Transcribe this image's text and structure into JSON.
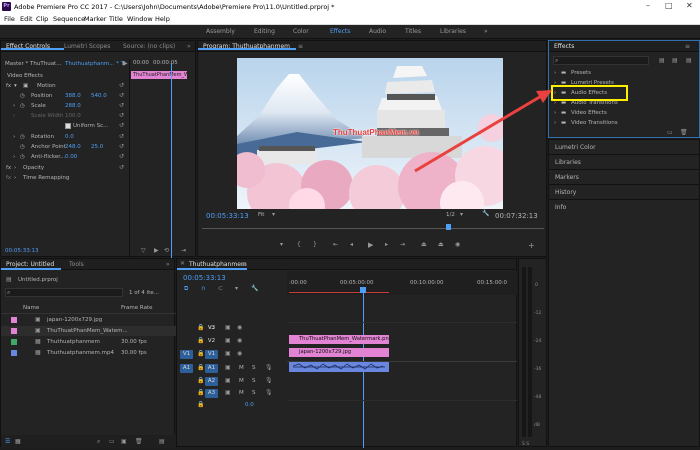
{
  "window": {
    "title": "Adobe Premiere Pro CC 2017 - C:\\Users\\John\\Documents\\Adobe\\Premiere Pro\\11.0\\Untitled.prproj *",
    "app_icon": "Pr"
  },
  "menu": [
    "File",
    "Edit",
    "Clip",
    "Sequence",
    "Marker",
    "Title",
    "Window",
    "Help"
  ],
  "workspaces": [
    "Assembly",
    "Editing",
    "Color",
    "Effects",
    "Audio",
    "Titles",
    "Libraries"
  ],
  "workspace_more": "»",
  "effect_controls": {
    "tabs": [
      "Effect Controls",
      "Lumetri Scopes",
      "Source: (no clips)"
    ],
    "tab_more": "»",
    "master": "Master * ThuThuat...",
    "clip": "Thuthuatphanm... * ThuThuat...",
    "ruler": [
      "00:00",
      "00:00:05"
    ],
    "clip_bar": "ThuThuatPhanMem_W",
    "section": "Video Effects",
    "motion": "Motion",
    "position_label": "Position",
    "position_x": "388.0",
    "position_y": "540.0",
    "scale_label": "Scale",
    "scale_val": "288.0",
    "scale_width_label": "Scale Width",
    "scale_width_val": "100.0",
    "uniform_scale": "Uniform Sc...",
    "rotation_label": "Rotation",
    "rotation_val": "0.0",
    "anchor_label": "Anchor Point",
    "anchor_x": "248.0",
    "anchor_y": "25.0",
    "antiflicker_label": "Anti-flicker...",
    "antiflicker_val": "0.00",
    "opacity": "Opacity",
    "time_remap": "Time Remapping",
    "timecode": "00:05:33:13"
  },
  "program": {
    "tab": "Program: Thuthuatphanmem",
    "tab_menu": "≡",
    "timecode": "00:05:33:13",
    "fit": "Fit",
    "fraction": "1/2",
    "duration": "00:07:32:13",
    "watermark": "ThuThuatPhanMem.vn"
  },
  "effects": {
    "tab": "Effects",
    "tab_menu": "≡",
    "search_placeholder": "",
    "items": [
      "Presets",
      "Lumetri Presets",
      "Audio Effects",
      "Audio Transitions",
      "Video Effects",
      "Video Transitions"
    ],
    "highlighted": "Audio Effects",
    "highlight_color": "#ffee00"
  },
  "side_panels": [
    "Lumetri Color",
    "Libraries",
    "Markers",
    "History",
    "Info"
  ],
  "project": {
    "tabs": [
      "Project: Untitled",
      "Tools"
    ],
    "tab_more": "»",
    "file": "Untitled.prproj",
    "count": "1 of 4 ite...",
    "columns": [
      "Name",
      "Frame Rate"
    ],
    "items": [
      {
        "name": "japan-1200x729.jpg",
        "rate": "",
        "color": "#e283d3"
      },
      {
        "name": "ThuThuatPhanMem_Watem...",
        "rate": "",
        "color": "#e283d3"
      },
      {
        "name": "Thuthuatphanmem",
        "rate": "30.00 fps",
        "color": "#3fa86b"
      },
      {
        "name": "Thuthuatphanmem.mp4",
        "rate": "30.00 fps",
        "color": "#6a87e0"
      }
    ]
  },
  "timeline": {
    "tab": "Thuthuatphanmem",
    "tab_menu": "≡",
    "timecode": "00:05:33:13",
    "ruler": [
      ":00:00",
      "00:05:00:00",
      "00:10:00:00",
      "00:15:00:0"
    ],
    "video_tracks": [
      "V3",
      "V2",
      "V1"
    ],
    "audio_tracks": [
      "A1",
      "A2",
      "A3"
    ],
    "source_v": "V1",
    "source_a": "A1",
    "master_vol": "0.0",
    "clip_watermark": "ThuThuatPhanMem_Watermark.png",
    "clip_japan": "japan-1200x729.jpg",
    "clip_color_pink": "#e283d3",
    "clip_color_blue": "#6a87e0",
    "track_ms": [
      "M",
      "S"
    ]
  },
  "accent": "#4f9ff7",
  "arrow_color": "#e8413e"
}
